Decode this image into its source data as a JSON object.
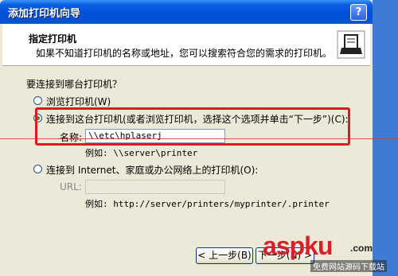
{
  "window": {
    "title": "添加打印机向导",
    "help_glyph": "?"
  },
  "header": {
    "title": "指定打印机",
    "subtitle": "如果不知道打印机的名称或地址，您可以搜索符合您的需求的打印机。",
    "icon": "printer-icon"
  },
  "question": "要连接到哪台打印机？",
  "options": {
    "browse": {
      "label": "浏览打印机(W)",
      "checked": false
    },
    "connect": {
      "label": "连接到这台打印机(或者浏览打印机，选择这个选项并单击“下一步”)(C):",
      "checked": true,
      "name_label": "名称:",
      "name_value": "\\\\etc\\hplaserj",
      "example": "例如: \\\\server\\printer"
    },
    "internet": {
      "label": "连接到 Internet、家庭或办公网络上的打印机(O):",
      "checked": false,
      "url_label": "URL:",
      "url_value": "",
      "example": "例如: http://server/printers/myprinter/.printer"
    }
  },
  "buttons": {
    "back": "< 上一步(B)",
    "next": "下一步(N) >"
  },
  "watermark": {
    "logo": "aspku",
    "tld": ".com",
    "sub": "免费网站源码下载站"
  },
  "colors": {
    "highlight": "#d81b1b",
    "titlebar": "#0050d8"
  }
}
